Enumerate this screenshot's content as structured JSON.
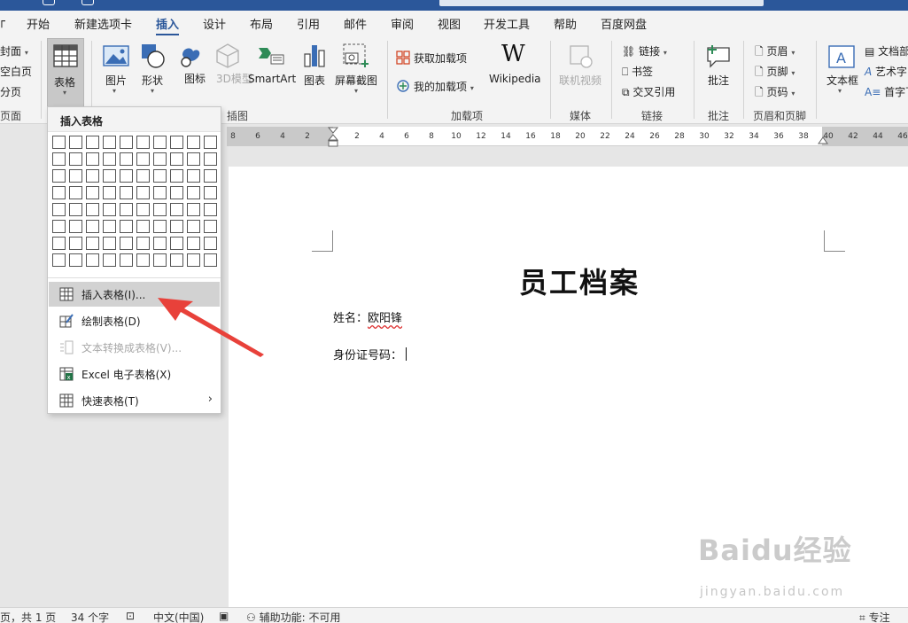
{
  "tabs": [
    {
      "label": "开始"
    },
    {
      "label": "新建选项卡"
    },
    {
      "label": "插入"
    },
    {
      "label": "设计"
    },
    {
      "label": "布局"
    },
    {
      "label": "引用"
    },
    {
      "label": "邮件"
    },
    {
      "label": "审阅"
    },
    {
      "label": "视图"
    },
    {
      "label": "开发工具"
    },
    {
      "label": "帮助"
    },
    {
      "label": "百度网盘"
    }
  ],
  "active_tab": "插入",
  "ribbon": {
    "pages_group": {
      "cover": "封面",
      "blank": "空白页",
      "break": "分页",
      "label": "页面"
    },
    "table_button": "表格",
    "picture": "图片",
    "shapes": "形状",
    "icons": "图标",
    "model3d": "3D模型",
    "smartart": "SmartArt",
    "chart": "图表",
    "screenshot": "屏幕截图",
    "illustrations_label": "插图",
    "get_addins": "获取加载项",
    "my_addins": "我的加载项",
    "wikipedia": "Wikipedia",
    "addins_label": "加载项",
    "online_video": "联机视频",
    "media_label": "媒体",
    "link": "链接",
    "bookmark": "书签",
    "cross_ref": "交叉引用",
    "links_label": "链接",
    "comment": "批注",
    "comments_label": "批注",
    "header": "页眉",
    "footer": "页脚",
    "page_number": "页码",
    "header_footer_label": "页眉和页脚",
    "textbox": "文本框",
    "doc_parts": "文档部件",
    "wordart": "艺术字",
    "drop_cap": "首字下沉"
  },
  "ruler_ticks": [
    "8",
    "6",
    "4",
    "2",
    "2",
    "4",
    "6",
    "8",
    "10",
    "12",
    "14",
    "16",
    "18",
    "20",
    "22",
    "24",
    "26",
    "28",
    "30",
    "32",
    "34",
    "36",
    "38",
    "40",
    "42",
    "44",
    "46"
  ],
  "dropdown": {
    "header": "插入表格",
    "grid_cols": 10,
    "grid_rows": 8,
    "items": [
      {
        "label": "插入表格(I)...",
        "icon": "table-icon",
        "hover": true,
        "disabled": false
      },
      {
        "label": "绘制表格(D)",
        "icon": "draw-table-icon",
        "hover": false,
        "disabled": false
      },
      {
        "label": "文本转换成表格(V)...",
        "icon": "convert-text-icon",
        "hover": false,
        "disabled": true
      },
      {
        "label": "Excel 电子表格(X)",
        "icon": "excel-icon",
        "hover": false,
        "disabled": false
      },
      {
        "label": "快速表格(T)",
        "icon": "quick-table-icon",
        "hover": false,
        "disabled": false,
        "submenu": true
      }
    ]
  },
  "document": {
    "title": "员工档案",
    "name_label": "姓名：",
    "name_value": "欧阳锋",
    "id_label": "身份证号码："
  },
  "status": {
    "pages": "页，共 1 页",
    "words": "34 个字",
    "language": "中文(中国)",
    "accessibility": "辅助功能: 不可用",
    "focus": "专注"
  },
  "watermark": {
    "brand": "Baidu经验",
    "url": "jingyan.baidu.com"
  },
  "colors": {
    "accent": "#2b579a",
    "annotation_arrow": "#e8413a"
  }
}
